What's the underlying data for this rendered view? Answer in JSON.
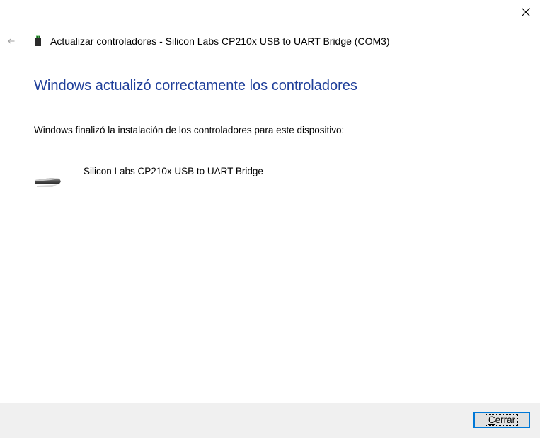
{
  "window": {
    "title": "Actualizar controladores - Silicon Labs CP210x USB to UART Bridge (COM3)"
  },
  "main": {
    "heading": "Windows actualizó correctamente los controladores",
    "description": "Windows finalizó la instalación de los controladores para este dispositivo:",
    "device_name": "Silicon Labs CP210x USB to UART Bridge"
  },
  "footer": {
    "close_button": {
      "accel": "C",
      "rest": "errar"
    }
  },
  "icons": {
    "close": "close-icon",
    "back": "back-arrow-icon",
    "device_small": "usb-device-icon",
    "device_large": "usb-connector-icon"
  },
  "colors": {
    "heading": "#1f3f9a",
    "footer_bg": "#f0f0f0",
    "button_focus": "#0078d7"
  }
}
